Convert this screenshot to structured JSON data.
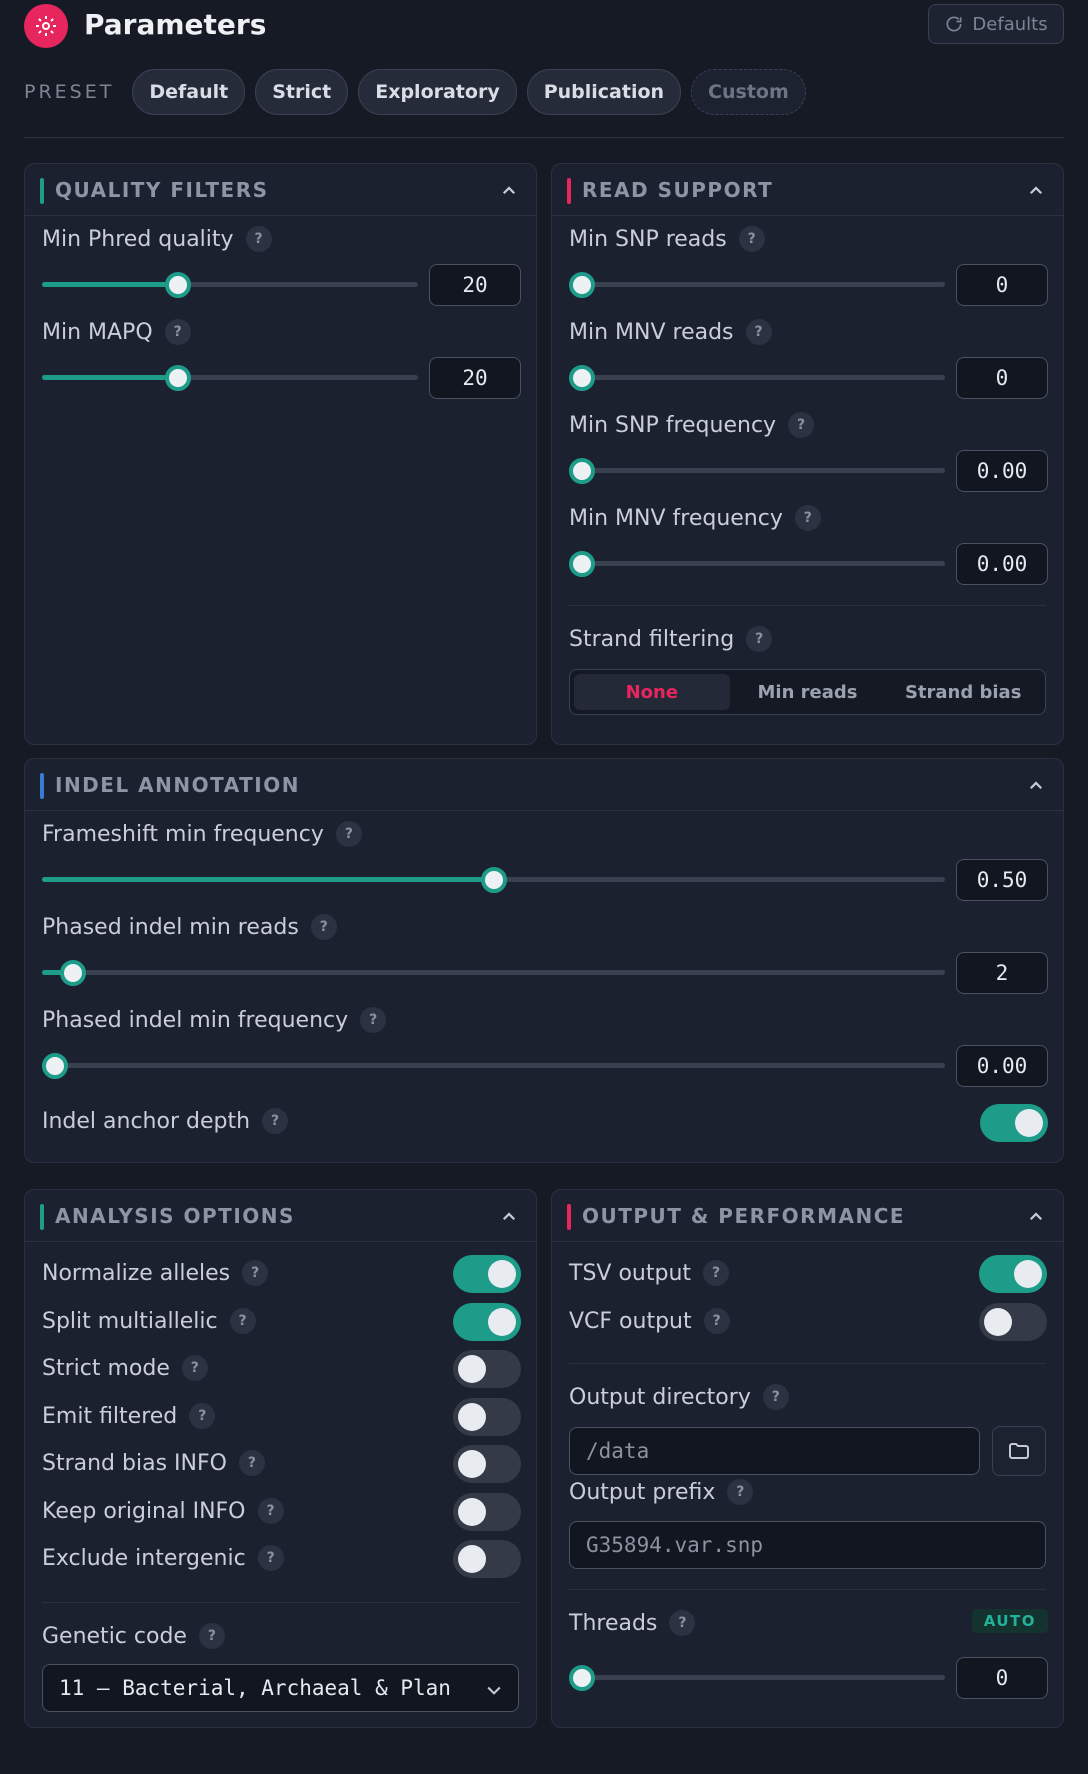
{
  "header": {
    "title": "Parameters",
    "defaults_label": "Defaults",
    "icon": "gear-icon",
    "accent": "#e8265e"
  },
  "preset": {
    "label": "PRESET",
    "options": [
      "Default",
      "Strict",
      "Exploratory",
      "Publication",
      "Custom"
    ]
  },
  "quality_filters": {
    "title": "QUALITY FILTERS",
    "bar_color": "#1e9c8a",
    "min_phred": {
      "label": "Min Phred quality",
      "value": "20",
      "fraction": 0.35
    },
    "min_mapq": {
      "label": "Min MAPQ",
      "value": "20",
      "fraction": 0.35
    }
  },
  "read_support": {
    "title": "READ SUPPORT",
    "bar_color": "#e8265e",
    "min_snp_reads": {
      "label": "Min SNP reads",
      "value": "0",
      "fraction": 0.0
    },
    "min_mnv_reads": {
      "label": "Min MNV reads",
      "value": "0",
      "fraction": 0.0
    },
    "min_snp_freq": {
      "label": "Min SNP frequency",
      "value": "0.00",
      "fraction": 0.0
    },
    "min_mnv_freq": {
      "label": "Min MNV frequency",
      "value": "0.00",
      "fraction": 0.0
    },
    "strand_filtering": {
      "label": "Strand filtering",
      "options": [
        "None",
        "Min reads",
        "Strand bias"
      ],
      "selected": "None"
    }
  },
  "indel_annotation": {
    "title": "INDEL ANNOTATION",
    "bar_color": "#3a7bd5",
    "frameshift": {
      "label": "Frameshift min frequency",
      "value": "0.50",
      "fraction": 0.5
    },
    "phased_reads": {
      "label": "Phased indel min reads",
      "value": "2",
      "fraction": 0.02
    },
    "phased_freq": {
      "label": "Phased indel min frequency",
      "value": "0.00",
      "fraction": 0.0
    },
    "anchor_depth": {
      "label": "Indel anchor depth",
      "on": true
    }
  },
  "analysis_options": {
    "title": "ANALYSIS OPTIONS",
    "bar_color": "#1e9c8a",
    "toggles": [
      {
        "label": "Normalize alleles",
        "on": true
      },
      {
        "label": "Split multiallelic",
        "on": true
      },
      {
        "label": "Strict mode",
        "on": false
      },
      {
        "label": "Emit filtered",
        "on": false
      },
      {
        "label": "Strand bias INFO",
        "on": false
      },
      {
        "label": "Keep original INFO",
        "on": false
      },
      {
        "label": "Exclude intergenic",
        "on": false
      }
    ],
    "genetic_code": {
      "label": "Genetic code",
      "value": "11 — Bacterial, Archaeal & Plan"
    }
  },
  "output": {
    "title": "OUTPUT & PERFORMANCE",
    "bar_color": "#e8265e",
    "tsv": {
      "label": "TSV output",
      "on": true
    },
    "vcf": {
      "label": "VCF output",
      "on": false
    },
    "output_dir": {
      "label": "Output directory",
      "placeholder": "/data"
    },
    "output_prefix": {
      "label": "Output prefix",
      "placeholder": "G35894.var.snp"
    },
    "threads": {
      "label": "Threads",
      "badge": "AUTO",
      "value": "0",
      "fraction": 0.0
    }
  },
  "help_glyph": "?"
}
